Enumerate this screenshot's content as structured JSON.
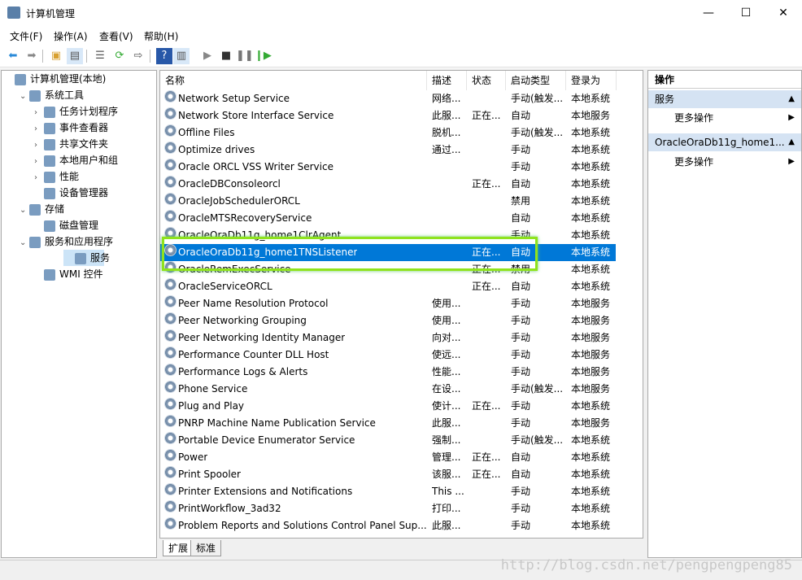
{
  "window": {
    "title": "计算机管理",
    "min": "—",
    "max": "☐",
    "close": "✕"
  },
  "menu": [
    "文件(F)",
    "操作(A)",
    "查看(V)",
    "帮助(H)"
  ],
  "tree": [
    {
      "label": "计算机管理(本地)",
      "level": 0,
      "exp": ""
    },
    {
      "label": "系统工具",
      "level": 1,
      "exp": "⌄"
    },
    {
      "label": "任务计划程序",
      "level": 2,
      "exp": "›"
    },
    {
      "label": "事件查看器",
      "level": 2,
      "exp": "›"
    },
    {
      "label": "共享文件夹",
      "level": 2,
      "exp": "›"
    },
    {
      "label": "本地用户和组",
      "level": 2,
      "exp": "›"
    },
    {
      "label": "性能",
      "level": 2,
      "exp": "›"
    },
    {
      "label": "设备管理器",
      "level": 2,
      "exp": ""
    },
    {
      "label": "存储",
      "level": 1,
      "exp": "⌄"
    },
    {
      "label": "磁盘管理",
      "level": 2,
      "exp": ""
    },
    {
      "label": "服务和应用程序",
      "level": 1,
      "exp": "⌄"
    },
    {
      "label": "服务",
      "level": 2,
      "exp": "",
      "selected": true
    },
    {
      "label": "WMI 控件",
      "level": 2,
      "exp": ""
    }
  ],
  "columns": {
    "name": "名称",
    "desc": "描述",
    "status": "状态",
    "startup": "启动类型",
    "logon": "登录为"
  },
  "services": [
    [
      "Network Setup Service",
      "网络...",
      "",
      "手动(触发...",
      "本地系统"
    ],
    [
      "Network Store Interface Service",
      "此服...",
      "正在...",
      "自动",
      "本地服务"
    ],
    [
      "Offline Files",
      "脱机...",
      "",
      "手动(触发...",
      "本地系统"
    ],
    [
      "Optimize drives",
      "通过...",
      "",
      "手动",
      "本地系统"
    ],
    [
      "Oracle ORCL VSS Writer Service",
      "",
      "",
      "手动",
      "本地系统"
    ],
    [
      "OracleDBConsoleorcl",
      "",
      "正在...",
      "自动",
      "本地系统"
    ],
    [
      "OracleJobSchedulerORCL",
      "",
      "",
      "禁用",
      "本地系统"
    ],
    [
      "OracleMTSRecoveryService",
      "",
      "",
      "自动",
      "本地系统"
    ],
    [
      "OracleOraDb11g_home1ClrAgent",
      "",
      "",
      "手动",
      "本地系统"
    ],
    [
      "OracleOraDb11g_home1TNSListener",
      "",
      "正在...",
      "自动",
      "本地系统"
    ],
    [
      "OracleRemExecService",
      "",
      "正在...",
      "禁用",
      "本地系统"
    ],
    [
      "OracleServiceORCL",
      "",
      "正在...",
      "自动",
      "本地系统"
    ],
    [
      "Peer Name Resolution Protocol",
      "使用...",
      "",
      "手动",
      "本地服务"
    ],
    [
      "Peer Networking Grouping",
      "使用...",
      "",
      "手动",
      "本地服务"
    ],
    [
      "Peer Networking Identity Manager",
      "向对...",
      "",
      "手动",
      "本地服务"
    ],
    [
      "Performance Counter DLL Host",
      "使远...",
      "",
      "手动",
      "本地服务"
    ],
    [
      "Performance Logs & Alerts",
      "性能...",
      "",
      "手动",
      "本地服务"
    ],
    [
      "Phone Service",
      "在设...",
      "",
      "手动(触发...",
      "本地服务"
    ],
    [
      "Plug and Play",
      "使计...",
      "正在...",
      "手动",
      "本地系统"
    ],
    [
      "PNRP Machine Name Publication Service",
      "此服...",
      "",
      "手动",
      "本地服务"
    ],
    [
      "Portable Device Enumerator Service",
      "强制...",
      "",
      "手动(触发...",
      "本地系统"
    ],
    [
      "Power",
      "管理...",
      "正在...",
      "自动",
      "本地系统"
    ],
    [
      "Print Spooler",
      "该服...",
      "正在...",
      "自动",
      "本地系统"
    ],
    [
      "Printer Extensions and Notifications",
      "This ...",
      "",
      "手动",
      "本地系统"
    ],
    [
      "PrintWorkflow_3ad32",
      "打印...",
      "",
      "手动",
      "本地系统"
    ],
    [
      "Problem Reports and Solutions Control Panel Sup...",
      "此服...",
      "",
      "手动",
      "本地系统"
    ]
  ],
  "selected_index": 9,
  "tabs": [
    "扩展",
    "标准"
  ],
  "actions": {
    "header": "操作",
    "sections": [
      {
        "title": "服务",
        "item": "更多操作"
      },
      {
        "title": "OracleOraDb11g_home1...",
        "item": "更多操作"
      }
    ]
  },
  "watermark": "http://blog.csdn.net/pengpengpeng85",
  "colors": {
    "selection": "#0078d7",
    "highlight": "#8fe31d"
  }
}
